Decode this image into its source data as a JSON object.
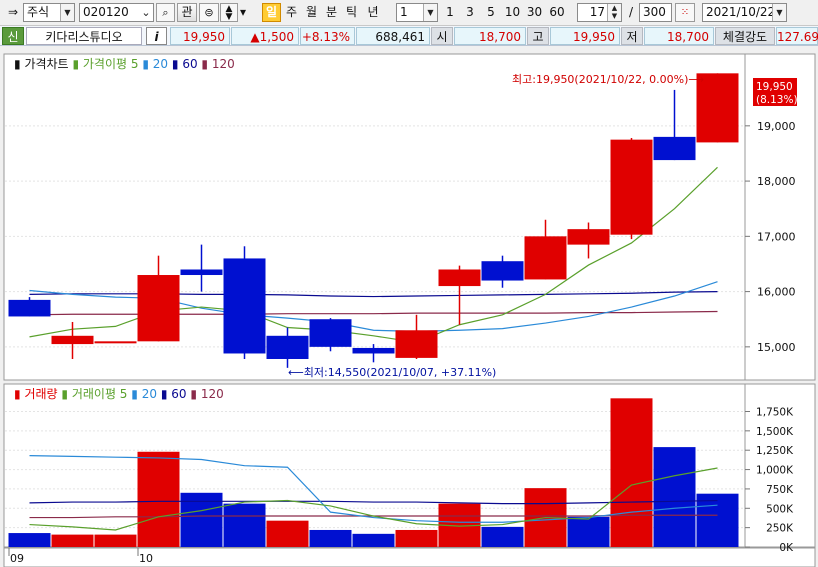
{
  "toolbar": {
    "market": "주식",
    "code": "020120",
    "related_label": "관",
    "periods": [
      "일",
      "주",
      "월",
      "분",
      "틱",
      "년"
    ],
    "active_period": "일",
    "period_select": "1",
    "quick_counts": [
      "1",
      "3",
      "5",
      "10",
      "30",
      "60"
    ],
    "display_count": "17",
    "separator": "/",
    "total_count": "300",
    "date": "2021/10/22"
  },
  "quote": {
    "credit_badge": "신",
    "stock_name": "키다리스튜디오",
    "info_label": "i",
    "price": "19,950",
    "change": "▲1,500",
    "change_pct": "+8.13%",
    "volume": "688,461",
    "open_label": "시",
    "open": "18,700",
    "high_label": "고",
    "high": "19,950",
    "low_label": "저",
    "low": "18,700",
    "strength_label": "체결강도",
    "strength": "127.69"
  },
  "colors": {
    "up": "#e00000",
    "down": "#0010d0",
    "ma5": "#5aa02c",
    "ma20": "#2a8ad8",
    "ma60": "#0a0a90",
    "ma120": "#8a2a4a"
  },
  "chart_data": [
    {
      "type": "candlestick",
      "legend": [
        {
          "label": "가격차트",
          "color": "#111111"
        },
        {
          "label": "가격이평 5",
          "color": "#5aa02c"
        },
        {
          "label": "20",
          "color": "#2a8ad8"
        },
        {
          "label": "60",
          "color": "#0a0a90"
        },
        {
          "label": "120",
          "color": "#8a2a4a"
        }
      ],
      "y_ticks": [
        15000,
        16000,
        17000,
        18000,
        19000
      ],
      "y_tick_labels": [
        "15,000",
        "16,000",
        "17,000",
        "18,000",
        "19,000"
      ],
      "ylim": [
        14400,
        20300
      ],
      "candles": [
        {
          "o": 15850,
          "h": 15900,
          "l": 15550,
          "c": 15550
        },
        {
          "o": 15050,
          "h": 15450,
          "l": 14780,
          "c": 15200
        },
        {
          "o": 15100,
          "h": 15100,
          "l": 15100,
          "c": 15100
        },
        {
          "o": 15100,
          "h": 16650,
          "l": 15100,
          "c": 16300
        },
        {
          "o": 16400,
          "h": 16850,
          "l": 16000,
          "c": 16300
        },
        {
          "o": 16600,
          "h": 16820,
          "l": 14780,
          "c": 14880
        },
        {
          "o": 15200,
          "h": 15350,
          "l": 14620,
          "c": 14780
        },
        {
          "o": 15500,
          "h": 15520,
          "l": 14920,
          "c": 15000
        },
        {
          "o": 14980,
          "h": 15050,
          "l": 14720,
          "c": 14880
        },
        {
          "o": 14800,
          "h": 15580,
          "l": 14780,
          "c": 15300
        },
        {
          "o": 16100,
          "h": 16470,
          "l": 15400,
          "c": 16400
        },
        {
          "o": 16550,
          "h": 16650,
          "l": 16070,
          "c": 16200
        },
        {
          "o": 16220,
          "h": 17300,
          "l": 16220,
          "c": 17000
        },
        {
          "o": 16850,
          "h": 17250,
          "l": 16600,
          "c": 17130
        },
        {
          "o": 17030,
          "h": 18780,
          "l": 16950,
          "c": 18750
        },
        {
          "o": 18800,
          "h": 19650,
          "l": 18380,
          "c": 18380
        },
        {
          "o": 18700,
          "h": 19950,
          "l": 18700,
          "c": 19950
        }
      ],
      "ma5": [
        15180,
        15320,
        15370,
        15650,
        15720,
        15650,
        15350,
        15300,
        15200,
        15080,
        15400,
        15580,
        15950,
        16480,
        16880,
        17500,
        18250
      ],
      "ma20": [
        16020,
        15950,
        15900,
        15880,
        15700,
        15580,
        15520,
        15450,
        15300,
        15280,
        15300,
        15330,
        15430,
        15550,
        15720,
        15920,
        16180
      ],
      "ma60": [
        15950,
        15960,
        15960,
        15960,
        15950,
        15950,
        15940,
        15920,
        15910,
        15920,
        15930,
        15940,
        15950,
        15960,
        15970,
        15990,
        16000
      ],
      "ma120": [
        15580,
        15590,
        15590,
        15590,
        15590,
        15590,
        15600,
        15600,
        15600,
        15610,
        15610,
        15610,
        15610,
        15620,
        15620,
        15630,
        15640
      ],
      "max_annotation": "최고:19,950(2021/10/22, 0.00%)⟶",
      "min_annotation": "⟵최저:14,550(2021/10/07, +37.11%)",
      "last_price_label": "19,950",
      "last_pct_label": "(8.13%)"
    },
    {
      "type": "bar",
      "legend": [
        {
          "label": "거래량",
          "color": "#111111"
        },
        {
          "label": "거래이평 5",
          "color": "#5aa02c"
        },
        {
          "label": "20",
          "color": "#2a8ad8"
        },
        {
          "label": "60",
          "color": "#0a0a90"
        },
        {
          "label": "120",
          "color": "#8a2a4a"
        }
      ],
      "y_ticks": [
        0,
        250000,
        500000,
        750000,
        1000000,
        1250000,
        1500000,
        1750000
      ],
      "y_tick_labels": [
        "0K",
        "250K",
        "500K",
        "750K",
        "1,000K",
        "1,250K",
        "1,500K",
        "1,750K"
      ],
      "ylim": [
        0,
        1950000
      ],
      "values": [
        180000,
        160000,
        160000,
        1230000,
        700000,
        560000,
        340000,
        220000,
        170000,
        220000,
        560000,
        260000,
        760000,
        390000,
        1920000,
        1290000,
        688461
      ],
      "up": [
        false,
        true,
        true,
        true,
        false,
        false,
        true,
        false,
        false,
        true,
        true,
        false,
        true,
        false,
        true,
        false,
        false
      ],
      "vma5": [
        290000,
        260000,
        220000,
        390000,
        470000,
        580000,
        600000,
        530000,
        400000,
        300000,
        270000,
        290000,
        380000,
        360000,
        800000,
        920000,
        1020000
      ],
      "vma20": [
        1180000,
        1170000,
        1160000,
        1150000,
        1130000,
        1050000,
        1030000,
        450000,
        380000,
        340000,
        320000,
        320000,
        350000,
        380000,
        450000,
        500000,
        540000
      ],
      "vma60": [
        570000,
        580000,
        580000,
        590000,
        590000,
        590000,
        590000,
        590000,
        580000,
        580000,
        570000,
        560000,
        560000,
        570000,
        580000,
        590000,
        600000
      ],
      "vma120": [
        380000,
        380000,
        390000,
        390000,
        400000,
        400000,
        400000,
        400000,
        400000,
        400000,
        400000,
        400000,
        400000,
        400000,
        410000,
        410000,
        410000
      ],
      "x_labels": [
        {
          "index": 0,
          "label": "09"
        },
        {
          "index": 3,
          "label": "10"
        }
      ]
    }
  ]
}
